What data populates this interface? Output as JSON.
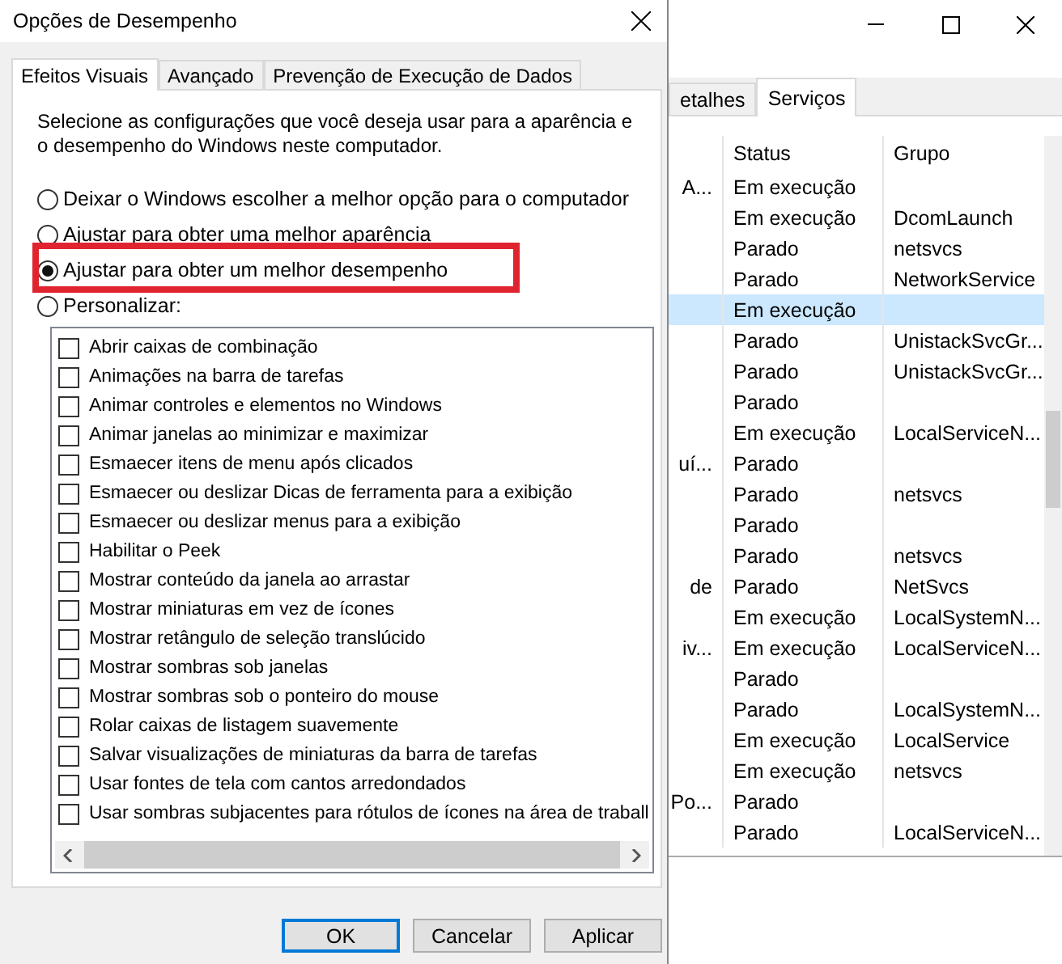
{
  "background_window": {
    "tabs": [
      {
        "label": "etalhes",
        "selected": false
      },
      {
        "label": "Serviços",
        "selected": true
      }
    ],
    "columns": [
      "Status",
      "Grupo"
    ],
    "rows": [
      {
        "name": "A...",
        "status": "Em execução",
        "group": "",
        "selected": false
      },
      {
        "name": "",
        "status": "Em execução",
        "group": "DcomLaunch",
        "selected": false
      },
      {
        "name": "",
        "status": "Parado",
        "group": "netsvcs",
        "selected": false
      },
      {
        "name": "",
        "status": "Parado",
        "group": "NetworkService",
        "selected": false
      },
      {
        "name": "",
        "status": "Em execução",
        "group": "",
        "selected": true
      },
      {
        "name": "",
        "status": "Parado",
        "group": "UnistackSvcGr...",
        "selected": false
      },
      {
        "name": "",
        "status": "Parado",
        "group": "UnistackSvcGr...",
        "selected": false
      },
      {
        "name": "",
        "status": "Parado",
        "group": "",
        "selected": false
      },
      {
        "name": "",
        "status": "Em execução",
        "group": "LocalServiceN...",
        "selected": false
      },
      {
        "name": "uí...",
        "status": "Parado",
        "group": "",
        "selected": false
      },
      {
        "name": "",
        "status": "Parado",
        "group": "netsvcs",
        "selected": false
      },
      {
        "name": "",
        "status": "Parado",
        "group": "",
        "selected": false
      },
      {
        "name": "",
        "status": "Parado",
        "group": "netsvcs",
        "selected": false
      },
      {
        "name": "de",
        "status": "Parado",
        "group": "NetSvcs",
        "selected": false
      },
      {
        "name": "",
        "status": "Em execução",
        "group": "LocalSystemN...",
        "selected": false
      },
      {
        "name": "iv...",
        "status": "Em execução",
        "group": "LocalServiceN...",
        "selected": false
      },
      {
        "name": "",
        "status": "Parado",
        "group": "",
        "selected": false
      },
      {
        "name": "",
        "status": "Parado",
        "group": "LocalSystemN...",
        "selected": false
      },
      {
        "name": "",
        "status": "Em execução",
        "group": "LocalService",
        "selected": false
      },
      {
        "name": "",
        "status": "Em execução",
        "group": "netsvcs",
        "selected": false
      },
      {
        "name": "Po...",
        "status": "Parado",
        "group": "",
        "selected": false
      },
      {
        "name": "",
        "status": "Parado",
        "group": "LocalServiceN...",
        "selected": false
      }
    ]
  },
  "dialog": {
    "title": "Opções de Desempenho",
    "tabs": [
      {
        "label": "Efeitos Visuais",
        "selected": true
      },
      {
        "label": "Avançado",
        "selected": false
      },
      {
        "label": "Prevenção de Execução de Dados",
        "selected": false
      }
    ],
    "description": "Selecione as configurações que você deseja usar para a aparência e o desempenho do Windows neste computador.",
    "options": [
      {
        "label": "Deixar o Windows escolher a melhor opção para o computador",
        "selected": false,
        "highlighted": false
      },
      {
        "label": "Ajustar para obter uma melhor aparência",
        "selected": false,
        "highlighted": false
      },
      {
        "label": "Ajustar para obter um melhor desempenho",
        "selected": true,
        "highlighted": true
      },
      {
        "label": "Personalizar:",
        "selected": false,
        "highlighted": false
      }
    ],
    "effects": [
      {
        "label": "Abrir caixas de combinação",
        "checked": false
      },
      {
        "label": "Animações na barra de tarefas",
        "checked": false
      },
      {
        "label": "Animar controles e elementos no Windows",
        "checked": false
      },
      {
        "label": "Animar janelas ao minimizar e maximizar",
        "checked": false
      },
      {
        "label": "Esmaecer itens de menu após clicados",
        "checked": false
      },
      {
        "label": "Esmaecer ou deslizar Dicas de ferramenta para a exibição",
        "checked": false
      },
      {
        "label": "Esmaecer ou deslizar menus para a exibição",
        "checked": false
      },
      {
        "label": "Habilitar o Peek",
        "checked": false
      },
      {
        "label": "Mostrar conteúdo da janela ao arrastar",
        "checked": false
      },
      {
        "label": "Mostrar miniaturas em vez de ícones",
        "checked": false
      },
      {
        "label": "Mostrar retângulo de seleção translúcido",
        "checked": false
      },
      {
        "label": "Mostrar sombras sob janelas",
        "checked": false
      },
      {
        "label": "Mostrar sombras sob o ponteiro do mouse",
        "checked": false
      },
      {
        "label": "Rolar caixas de listagem suavemente",
        "checked": false
      },
      {
        "label": "Salvar visualizações de miniaturas da barra de tarefas",
        "checked": false
      },
      {
        "label": "Usar fontes de tela com cantos arredondados",
        "checked": false
      },
      {
        "label": "Usar sombras subjacentes para rótulos de ícones na área de traball",
        "checked": false
      }
    ],
    "buttons": [
      {
        "label": "OK",
        "default": true
      },
      {
        "label": "Cancelar",
        "default": false
      },
      {
        "label": "Aplicar",
        "default": false
      }
    ]
  }
}
